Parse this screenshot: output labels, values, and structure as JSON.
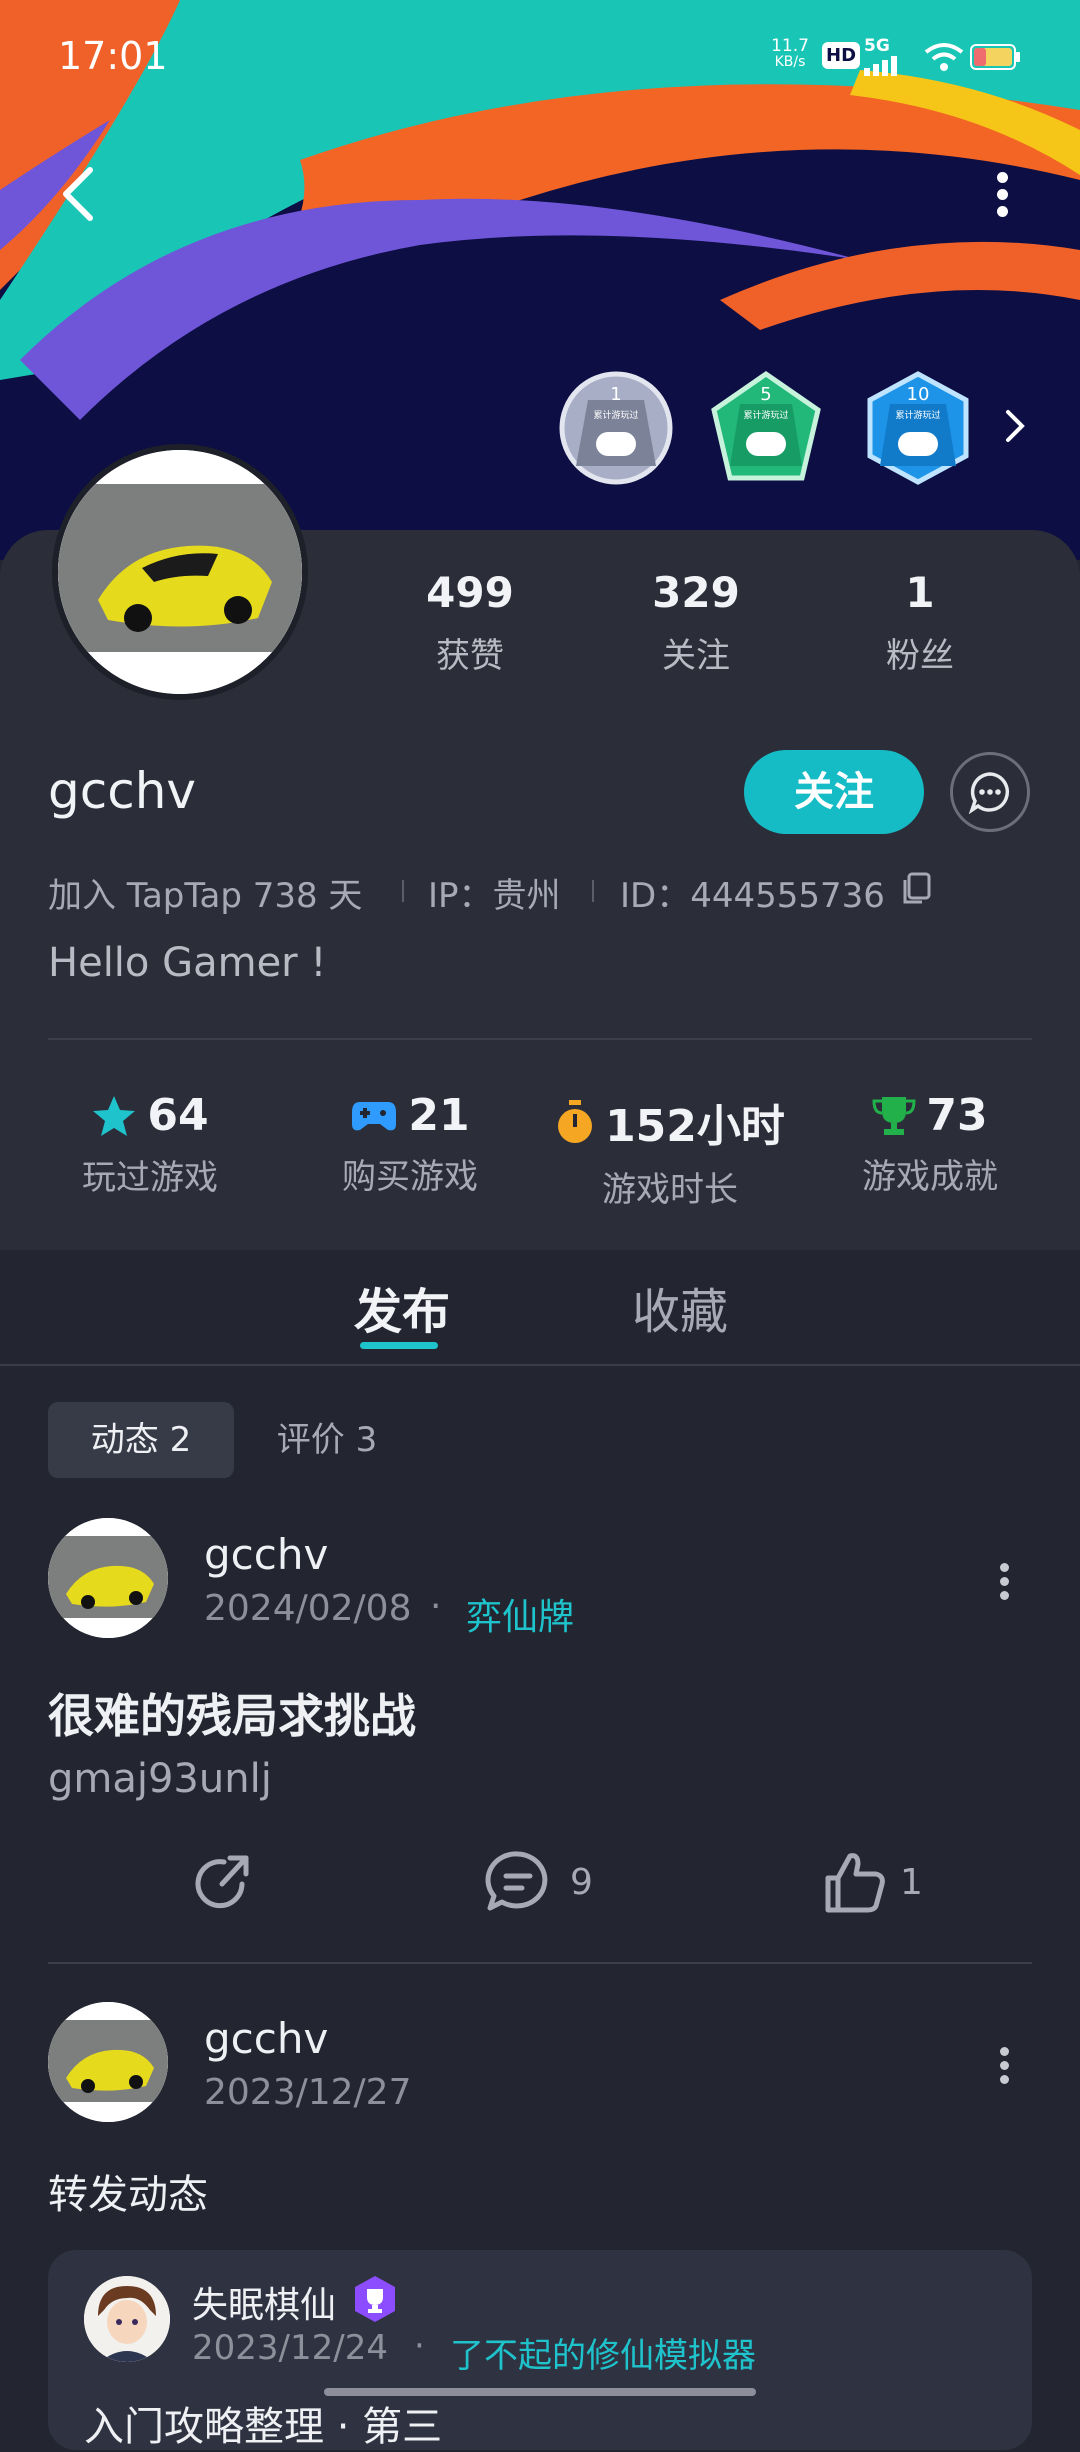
{
  "status": {
    "time": "17:01",
    "speed_value": "11.7",
    "speed_unit": "KB/s",
    "hd": "HD",
    "network": "5G"
  },
  "badges": [
    {
      "level": "1",
      "text": "累计游玩过"
    },
    {
      "level": "5",
      "text": "累计游玩过"
    },
    {
      "level": "10",
      "text": "累计游玩过"
    }
  ],
  "profile": {
    "username": "gcchv",
    "stats": [
      {
        "value": "499",
        "label": "获赞"
      },
      {
        "value": "329",
        "label": "关注"
      },
      {
        "value": "1",
        "label": "粉丝"
      }
    ],
    "follow_label": "关注",
    "joined": "加入 TapTap 738 天",
    "ip": "IP：贵州",
    "id": "ID：444555736",
    "bio": "Hello Gamer !"
  },
  "game_stats": [
    {
      "value": "64",
      "label": "玩过游戏",
      "icon": "star-icon",
      "color": "#1ec3cc"
    },
    {
      "value": "21",
      "label": "购买游戏",
      "icon": "gamepad-icon",
      "color": "#2f9bff"
    },
    {
      "value": "152小时",
      "label": "游戏时长",
      "icon": "stopwatch-icon",
      "color": "#f5a623"
    },
    {
      "value": "73",
      "label": "游戏成就",
      "icon": "trophy-icon",
      "color": "#22b04b"
    }
  ],
  "tabs": {
    "publish": "发布",
    "favorites": "收藏"
  },
  "subtabs": {
    "moments": "动态 2",
    "reviews": "评价 3"
  },
  "posts": [
    {
      "author": "gcchv",
      "date": "2024/02/08",
      "dot": "·",
      "game": "弈仙牌",
      "title": "很难的残局求挑战",
      "body": "gmaj93unlj",
      "comments": "9",
      "likes": "1"
    },
    {
      "author": "gcchv",
      "date": "2023/12/27",
      "title": "转发动态"
    }
  ],
  "repost": {
    "author": "失眠棋仙",
    "date": "2023/12/24",
    "dot": "·",
    "game": "了不起的修仙模拟器",
    "snippet": "入门攻略整理 · 第三"
  }
}
